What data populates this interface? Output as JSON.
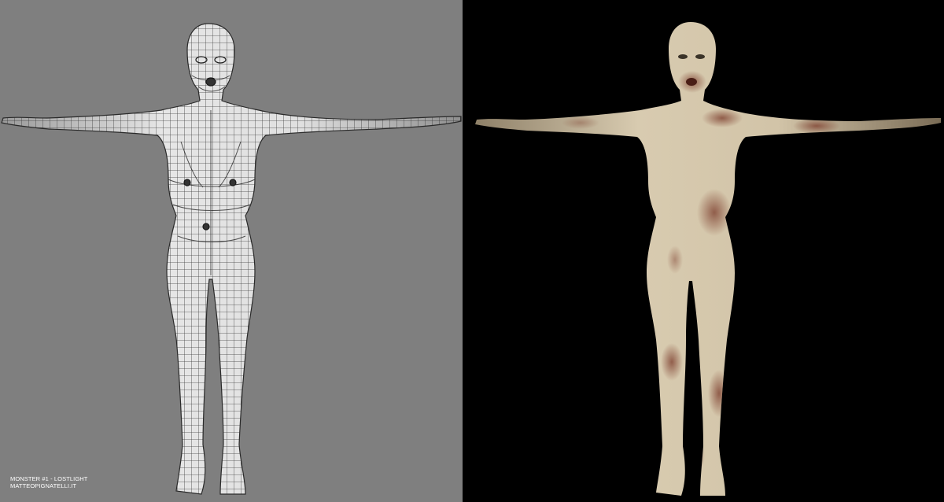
{
  "caption": {
    "line1": "MONSTER #1 - LOSTLIGHT",
    "line2": "MATTEOPIGNATELLI.IT"
  },
  "colors": {
    "wireframe_background": "#7f7f7f",
    "render_background": "#000000",
    "mesh_surface": "#d9d9d9",
    "mesh_lines": "#2a2a2a",
    "skin_base": "#cdbfa4",
    "skin_stain": "#7a3a2a",
    "caption_text": "#ffffff"
  },
  "panels": [
    {
      "name": "wireframe-view",
      "content": "t-pose-figure-wireframe"
    },
    {
      "name": "textured-render-view",
      "content": "t-pose-figure-textured"
    }
  ]
}
